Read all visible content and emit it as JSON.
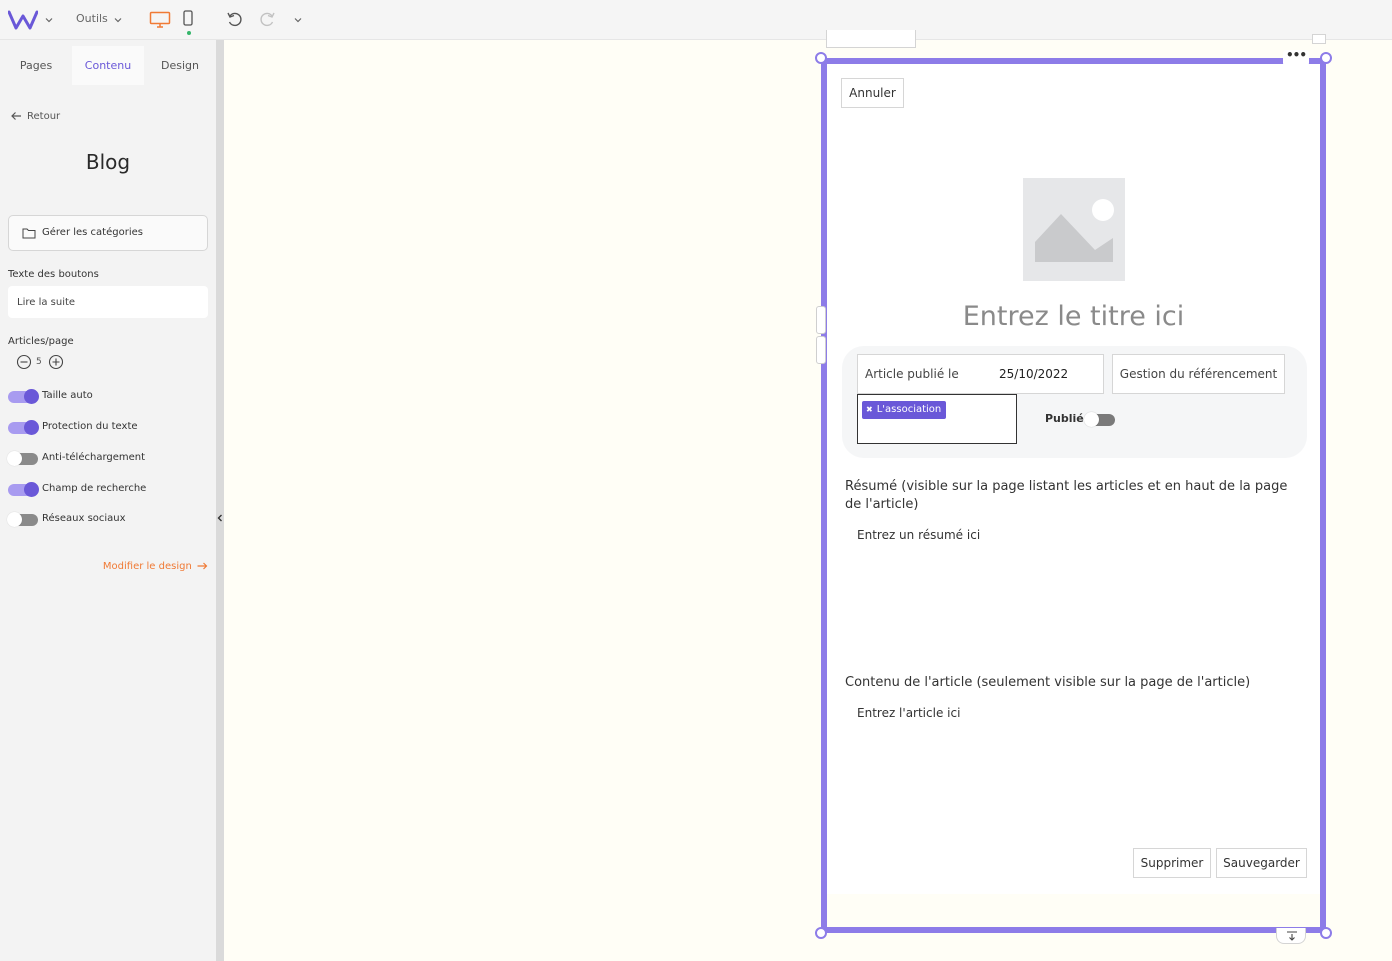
{
  "topbar": {
    "tools_label": "Outils"
  },
  "sidebar": {
    "tabs": [
      {
        "label": "Pages"
      },
      {
        "label": "Contenu"
      },
      {
        "label": "Design"
      }
    ],
    "back_label": "Retour",
    "title": "Blog",
    "categories_button": "Gérer les catégories",
    "button_text_label": "Texte des boutons",
    "button_text_value": "Lire la suite",
    "articles_per_page_label": "Articles/page",
    "articles_per_page_value": "5",
    "toggles": [
      {
        "label": "Taille auto",
        "on": true
      },
      {
        "label": "Protection du texte",
        "on": true
      },
      {
        "label": "Anti-téléchargement",
        "on": false
      },
      {
        "label": "Champ de recherche",
        "on": true
      },
      {
        "label": "Réseaux sociaux",
        "on": false
      }
    ],
    "modify_design_link": "Modifier le design"
  },
  "editor": {
    "cancel_button": "Annuler",
    "title_placeholder": "Entrez le titre ici",
    "published_on_label": "Article publié le",
    "published_date": "25/10/2022",
    "seo_button": "Gestion du référencement",
    "category_chip": "L'association",
    "published_label": "Publié",
    "published": false,
    "summary_label": "Résumé (visible sur la page listant les articles et en haut de la page de l'article)",
    "summary_placeholder": "Entrez un résumé ici",
    "content_label": "Contenu de l'article (seulement visible sur la page de l'article)",
    "content_placeholder": "Entrez l'article ici",
    "delete_button": "Supprimer",
    "save_button": "Sauvegarder"
  },
  "colors": {
    "accent": "#6a58d8",
    "frame": "#8d7ce8",
    "link": "#f07a35",
    "canvas": "#fffef6"
  }
}
